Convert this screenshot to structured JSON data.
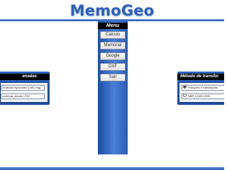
{
  "app": {
    "title": "MemoGeo"
  },
  "menu": {
    "header": "Menu",
    "items": [
      {
        "label": "Cálculo"
      },
      {
        "label": "Memorial"
      },
      {
        "label": "Google"
      },
      {
        "label": "DXF"
      },
      {
        "label": "Sair"
      }
    ]
  },
  "coordinates_panel": {
    "title": "enadas",
    "options": [
      {
        "label": "oodeicas elpsoidais (Lat/Long)",
        "selected": false
      },
      {
        "label": "oodeicas planas UTM",
        "selected": false
      }
    ]
  },
  "transformation_panel": {
    "title": "Método de transfor",
    "options": [
      {
        "label": "Rotações e translações",
        "selected": true
      },
      {
        "label": "NBR 14166:1998",
        "selected": false
      }
    ]
  },
  "colors": {
    "accent_blue": "#2e5fb8",
    "panel_blue": "#2f64c0",
    "header_black": "#000000"
  }
}
